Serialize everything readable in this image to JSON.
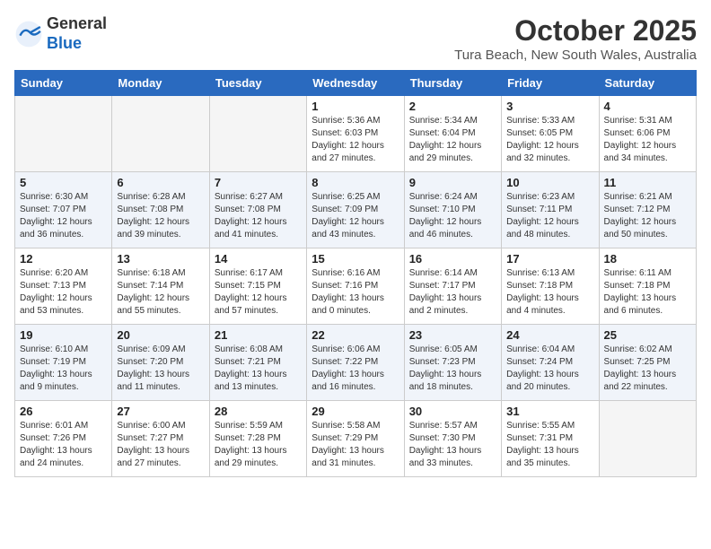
{
  "header": {
    "logo_general": "General",
    "logo_blue": "Blue",
    "month_title": "October 2025",
    "location": "Tura Beach, New South Wales, Australia"
  },
  "days_of_week": [
    "Sunday",
    "Monday",
    "Tuesday",
    "Wednesday",
    "Thursday",
    "Friday",
    "Saturday"
  ],
  "weeks": [
    [
      {
        "day": "",
        "empty": true
      },
      {
        "day": "",
        "empty": true
      },
      {
        "day": "",
        "empty": true
      },
      {
        "day": "1",
        "sunrise": "5:36 AM",
        "sunset": "6:03 PM",
        "daylight": "12 hours and 27 minutes."
      },
      {
        "day": "2",
        "sunrise": "5:34 AM",
        "sunset": "6:04 PM",
        "daylight": "12 hours and 29 minutes."
      },
      {
        "day": "3",
        "sunrise": "5:33 AM",
        "sunset": "6:05 PM",
        "daylight": "12 hours and 32 minutes."
      },
      {
        "day": "4",
        "sunrise": "5:31 AM",
        "sunset": "6:06 PM",
        "daylight": "12 hours and 34 minutes."
      }
    ],
    [
      {
        "day": "5",
        "sunrise": "6:30 AM",
        "sunset": "7:07 PM",
        "daylight": "12 hours and 36 minutes."
      },
      {
        "day": "6",
        "sunrise": "6:28 AM",
        "sunset": "7:08 PM",
        "daylight": "12 hours and 39 minutes."
      },
      {
        "day": "7",
        "sunrise": "6:27 AM",
        "sunset": "7:08 PM",
        "daylight": "12 hours and 41 minutes."
      },
      {
        "day": "8",
        "sunrise": "6:25 AM",
        "sunset": "7:09 PM",
        "daylight": "12 hours and 43 minutes."
      },
      {
        "day": "9",
        "sunrise": "6:24 AM",
        "sunset": "7:10 PM",
        "daylight": "12 hours and 46 minutes."
      },
      {
        "day": "10",
        "sunrise": "6:23 AM",
        "sunset": "7:11 PM",
        "daylight": "12 hours and 48 minutes."
      },
      {
        "day": "11",
        "sunrise": "6:21 AM",
        "sunset": "7:12 PM",
        "daylight": "12 hours and 50 minutes."
      }
    ],
    [
      {
        "day": "12",
        "sunrise": "6:20 AM",
        "sunset": "7:13 PM",
        "daylight": "12 hours and 53 minutes."
      },
      {
        "day": "13",
        "sunrise": "6:18 AM",
        "sunset": "7:14 PM",
        "daylight": "12 hours and 55 minutes."
      },
      {
        "day": "14",
        "sunrise": "6:17 AM",
        "sunset": "7:15 PM",
        "daylight": "12 hours and 57 minutes."
      },
      {
        "day": "15",
        "sunrise": "6:16 AM",
        "sunset": "7:16 PM",
        "daylight": "13 hours and 0 minutes."
      },
      {
        "day": "16",
        "sunrise": "6:14 AM",
        "sunset": "7:17 PM",
        "daylight": "13 hours and 2 minutes."
      },
      {
        "day": "17",
        "sunrise": "6:13 AM",
        "sunset": "7:18 PM",
        "daylight": "13 hours and 4 minutes."
      },
      {
        "day": "18",
        "sunrise": "6:11 AM",
        "sunset": "7:18 PM",
        "daylight": "13 hours and 6 minutes."
      }
    ],
    [
      {
        "day": "19",
        "sunrise": "6:10 AM",
        "sunset": "7:19 PM",
        "daylight": "13 hours and 9 minutes."
      },
      {
        "day": "20",
        "sunrise": "6:09 AM",
        "sunset": "7:20 PM",
        "daylight": "13 hours and 11 minutes."
      },
      {
        "day": "21",
        "sunrise": "6:08 AM",
        "sunset": "7:21 PM",
        "daylight": "13 hours and 13 minutes."
      },
      {
        "day": "22",
        "sunrise": "6:06 AM",
        "sunset": "7:22 PM",
        "daylight": "13 hours and 16 minutes."
      },
      {
        "day": "23",
        "sunrise": "6:05 AM",
        "sunset": "7:23 PM",
        "daylight": "13 hours and 18 minutes."
      },
      {
        "day": "24",
        "sunrise": "6:04 AM",
        "sunset": "7:24 PM",
        "daylight": "13 hours and 20 minutes."
      },
      {
        "day": "25",
        "sunrise": "6:02 AM",
        "sunset": "7:25 PM",
        "daylight": "13 hours and 22 minutes."
      }
    ],
    [
      {
        "day": "26",
        "sunrise": "6:01 AM",
        "sunset": "7:26 PM",
        "daylight": "13 hours and 24 minutes."
      },
      {
        "day": "27",
        "sunrise": "6:00 AM",
        "sunset": "7:27 PM",
        "daylight": "13 hours and 27 minutes."
      },
      {
        "day": "28",
        "sunrise": "5:59 AM",
        "sunset": "7:28 PM",
        "daylight": "13 hours and 29 minutes."
      },
      {
        "day": "29",
        "sunrise": "5:58 AM",
        "sunset": "7:29 PM",
        "daylight": "13 hours and 31 minutes."
      },
      {
        "day": "30",
        "sunrise": "5:57 AM",
        "sunset": "7:30 PM",
        "daylight": "13 hours and 33 minutes."
      },
      {
        "day": "31",
        "sunrise": "5:55 AM",
        "sunset": "7:31 PM",
        "daylight": "13 hours and 35 minutes."
      },
      {
        "day": "",
        "empty": true
      }
    ]
  ],
  "labels": {
    "sunrise_prefix": "Sunrise: ",
    "sunset_prefix": "Sunset: ",
    "daylight_prefix": "Daylight: "
  }
}
